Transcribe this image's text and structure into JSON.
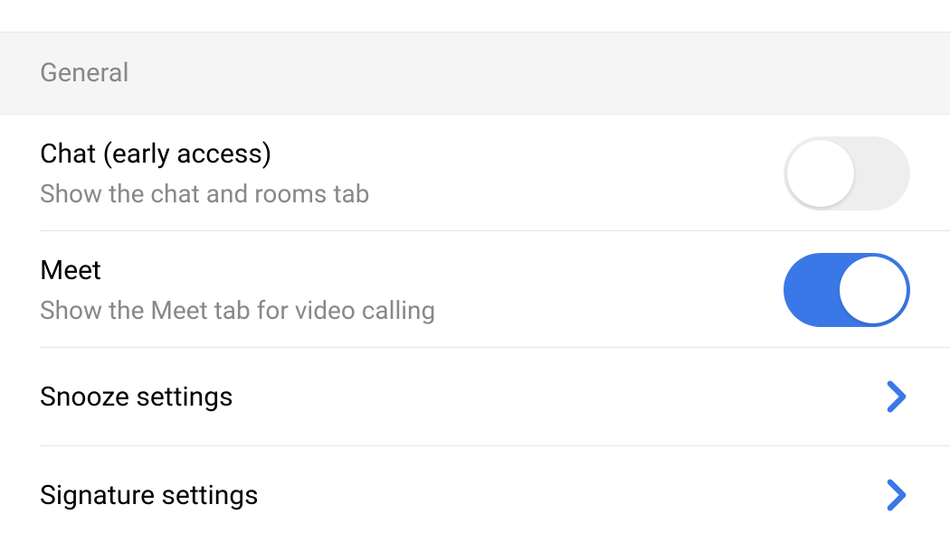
{
  "section": {
    "title": "General"
  },
  "items": {
    "chat": {
      "title": "Chat (early access)",
      "subtitle": "Show the chat and rooms tab",
      "enabled": false
    },
    "meet": {
      "title": "Meet",
      "subtitle": "Show the Meet tab for video calling",
      "enabled": true
    },
    "snooze": {
      "title": "Snooze settings"
    },
    "signature": {
      "title": "Signature settings"
    }
  },
  "colors": {
    "accent": "#3b78e7",
    "toggle_off": "#eeeeee",
    "text_secondary": "#888888"
  }
}
